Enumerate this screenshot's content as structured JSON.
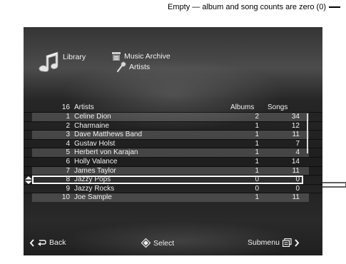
{
  "callouts": {
    "empty_note": "Empty — album and song counts are zero (0)"
  },
  "breadcrumb": {
    "library": "Library",
    "music_archive": "Music Archive",
    "artists": "Artists"
  },
  "icons": {
    "library": "music-note-icon",
    "music_archive": "archive-icon",
    "artists": "microphone-icon",
    "selection": "up-down-arrows-icon",
    "back": "return-arrow-icon",
    "select": "diamond-dpad-icon",
    "submenu": "submenu-icon"
  },
  "list": {
    "count": "16",
    "header_name": "Artists",
    "header_albums": "Albums",
    "header_songs": "Songs",
    "rows": [
      {
        "num": "1",
        "name": "Celine Dion",
        "albums": "2",
        "songs": "34"
      },
      {
        "num": "2",
        "name": "Charmaine",
        "albums": "1",
        "songs": "12"
      },
      {
        "num": "3",
        "name": "Dave Matthews Band",
        "albums": "1",
        "songs": "11"
      },
      {
        "num": "4",
        "name": "Gustav Holst",
        "albums": "1",
        "songs": "7"
      },
      {
        "num": "5",
        "name": "Herbert von Karajan",
        "albums": "1",
        "songs": "4"
      },
      {
        "num": "6",
        "name": "Holly Valance",
        "albums": "1",
        "songs": "14"
      },
      {
        "num": "7",
        "name": "James Taylor",
        "albums": "1",
        "songs": "11"
      },
      {
        "num": "8",
        "name": "Jazzy Pops",
        "albums": "0",
        "songs": "0"
      },
      {
        "num": "9",
        "name": "Jazzy Rocks",
        "albums": "0",
        "songs": "0"
      },
      {
        "num": "10",
        "name": "Joe Sample",
        "albums": "1",
        "songs": "11"
      }
    ],
    "selected_index": 7
  },
  "bottom_bar": {
    "back": "Back",
    "select": "Select",
    "submenu": "Submenu"
  }
}
